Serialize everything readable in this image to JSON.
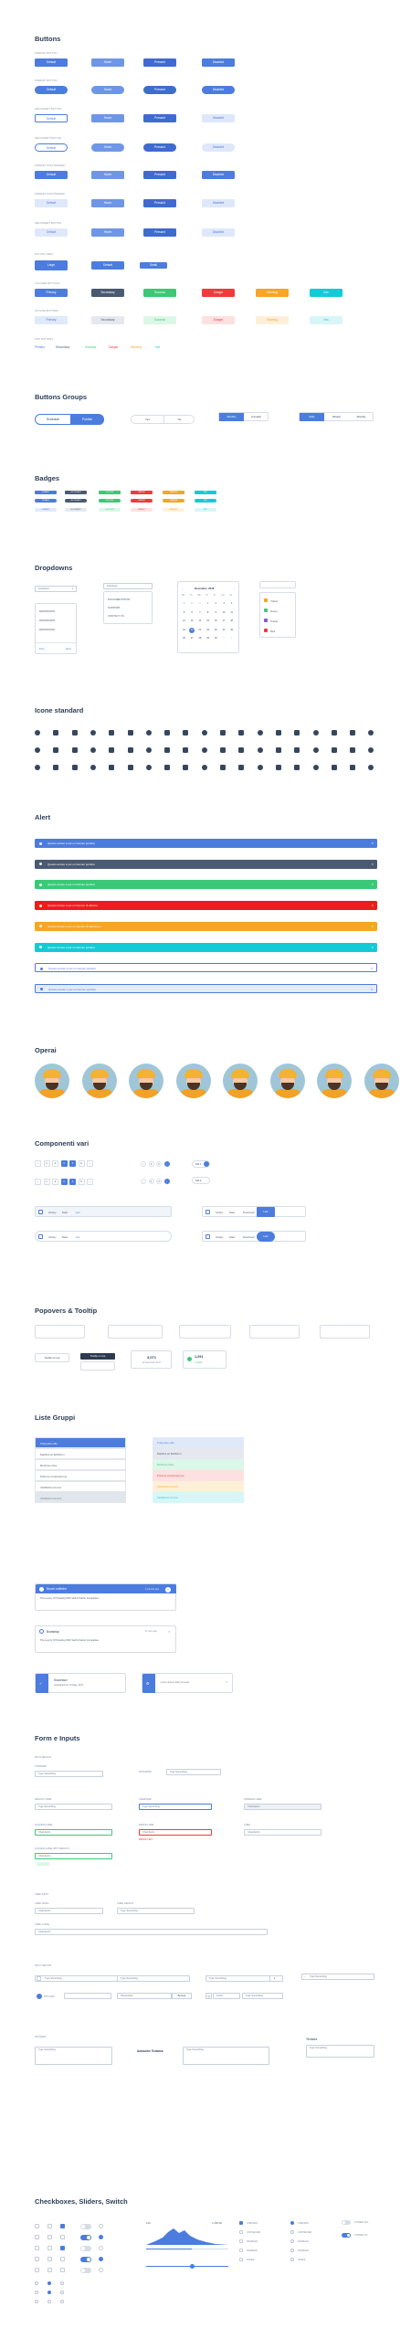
{
  "sections": {
    "buttons": "Buttons",
    "button_groups": "Buttons Groups",
    "badges": "Badges",
    "dropdowns": "Dropdowns",
    "icons": "Icone standard",
    "alert": "Alert",
    "operai": "Operai",
    "components": "Componenti vari",
    "popovers": "Popovers & Tooltip",
    "lists": "Liste Gruppi",
    "forms": "Form e Inputs",
    "checkboxes": "Checkboxes, Sliders, Switch"
  },
  "buttons": {
    "states": [
      "Default",
      "Hover",
      "Pressed",
      "Disabled"
    ],
    "row_captions": [
      "PRIMARY BUTTON",
      "PRIMARY BUTTON",
      "SECONDARY BUTTON",
      "SECONDARY BUTTON",
      "PRIMARY WITH BORDER",
      "PRIMARY WITH BORDER",
      "SECONDARY BUTTON",
      "SECONDARY BUTTON"
    ],
    "sizes_caption": "BUTTON SIZES",
    "sizes": [
      "Large",
      "Default",
      "Small"
    ],
    "colors_caption": "COLORED BUTTONS",
    "colors": [
      "Primary",
      "Secondary",
      "Success",
      "Danger",
      "Warning",
      "Info"
    ],
    "outline_caption": "OUTLINE BUTTONS",
    "link_caption": "LINK BUTTONS"
  },
  "button_groups": {
    "g1": [
      "Schedule",
      "Publish"
    ],
    "g2": [
      "Yes",
      "No"
    ],
    "g3": [
      "Monthly",
      "Annually"
    ],
    "g4": [
      "Daily",
      "Weekly",
      "Monthly"
    ]
  },
  "badges": {
    "labels": [
      "PRIMARY",
      "SECONDARY",
      "SUCCESS",
      "DANGER",
      "WARNING",
      "INFO"
    ]
  },
  "dropdowns": {
    "select_label": "Dropdown",
    "items_a": [
      "DROPDOWN",
      "DROPDOWN",
      "DROPDOWN"
    ],
    "footer_a": [
      "Prev",
      "Next"
    ],
    "items_b_header": "Dropdown",
    "items_b": [
      "DOCUMENTATION",
      "SUPPORT",
      "CONTACT US"
    ],
    "calendar_title": "November, 2018",
    "weekdays": [
      "Mo",
      "Tu",
      "We",
      "Th",
      "Fr",
      "Sa",
      "Su"
    ],
    "days": [
      "29",
      "30",
      "31",
      "1",
      "2",
      "3",
      "4",
      "5",
      "6",
      "7",
      "8",
      "9",
      "10",
      "11",
      "12",
      "13",
      "14",
      "15",
      "16",
      "17",
      "18",
      "19",
      "20",
      "21",
      "22",
      "23",
      "24",
      "25",
      "26",
      "27",
      "28",
      "29",
      "30",
      "1",
      "2"
    ],
    "color_items": [
      "Yellow",
      "Green",
      "Purple",
      "Red"
    ]
  },
  "alerts": [
    {
      "text": "Questo avviso è per un banner positivo",
      "color": "#4c7cdd"
    },
    {
      "text": "Questo avviso è per un banner positivo",
      "color": "#4a5a72"
    },
    {
      "text": "Questo avviso è per un banner positivo",
      "color": "#3ac976"
    },
    {
      "text": "Questo avviso è per un banner di allarme",
      "color": "#ee1c1c"
    },
    {
      "text": "Questo avviso è per un banner di attenzione",
      "color": "#f5a623"
    },
    {
      "text": "Questo avviso è per un banner positivo",
      "color": "#13cbd6"
    },
    {
      "text": "Questo avviso è per un banner positivo",
      "color": "#ffffff"
    },
    {
      "text": "Questo avviso è per un banner positivo",
      "color": "#e3ebfa"
    }
  ],
  "components": {
    "pag1": [
      "1",
      "2",
      "3",
      "4",
      "5"
    ],
    "pag2": [
      "1",
      "2",
      "3",
      "4",
      "5"
    ],
    "tab_chips": [
      "Tab 1",
      "Tab 2"
    ],
    "nav1": [
      "Library",
      "Data",
      "List"
    ],
    "nav2": [
      "Library",
      "Data",
      "List"
    ],
    "nav3": [
      "Library",
      "Data",
      "Download",
      "Link"
    ],
    "nav4": [
      "Library",
      "Data",
      "Download",
      "Link"
    ]
  },
  "popovers": {
    "tooltip_left": "Tooltip on top",
    "tooltip_dark": "Tooltip on top",
    "price": "3,071",
    "price_sub": "12 December 2017",
    "stat": "1,291",
    "stat_sub": "+12.4%"
  },
  "lists": {
    "left": [
      "Cras justo odio",
      "Dapibus ac facilisis in",
      "Morbi leo risus",
      "Porta ac consectetur ac",
      "Vestibulum at eros",
      "Vestibulum at eros"
    ],
    "right": [
      "Cras justo odio",
      "Dapibus ac facilisis in",
      "Morbi leo risus",
      "Porta ac consectetur ac",
      "Vestibulum at eros",
      "Vestibulum at eros"
    ]
  },
  "notifications": {
    "n1_title": "Nuovo notifiche",
    "n1_time": "2 minutes ago",
    "n1_body": "The Luxury Of Traveling With Yacht Charter Companies",
    "n2_title": "Bootstrap",
    "n2_time": "11 mins ago",
    "n2_body": "The Luxury Of Traveling With Yacht Charter Companies",
    "n3_title": "Successo!",
    "n3_body": "Scheduled for 14 May, 2017",
    "n4_body": "Lorem ipsum dolor sit amet"
  },
  "forms": {
    "default_caption": "INPUT DEFAULT",
    "default_label": "STANDARD",
    "placeholder": "Type Something",
    "password_label": "PASSWORD",
    "label1": "DEFAULT LABEL",
    "label2": "USERNAME",
    "label3": "DISABLED LABEL",
    "label4": "SUCCESS LABEL",
    "label5": "ERROR LABEL",
    "label6": "LABEL",
    "value": "Chambertin",
    "error_text": "Error text",
    "success_sub_label": "SUCCESS LABEL WITH RESULTS",
    "label_caption": "LABEL INPUT",
    "label_small": "LABEL SMALL",
    "label_default": "LABEL DEFAULT",
    "label_large": "LABEL LARGE",
    "input_caption": "INPUT GROUPS",
    "stepper": "Type Something",
    "pin_label": "PIN CODE",
    "password": "Placeholder",
    "browse": "Browse",
    "time": "12:00",
    "textarea_caption": "TEXTAREA",
    "textarea_label": "Awesome Textarea",
    "textarea_right": "Textarea"
  },
  "checks": {
    "chart_left": "120",
    "chart_right": "1,250.00",
    "checkbox_labels": [
      "CHECKED",
      "UNCHECKED",
      "DISABLED",
      "DISABLED",
      "HOVER"
    ],
    "radio_labels": [
      "CHECKED",
      "UNCHECKED",
      "DISABLED",
      "DISABLED",
      "HOVER"
    ],
    "switch_labels": [
      "TURNED OFF",
      "TURNED ON"
    ]
  }
}
